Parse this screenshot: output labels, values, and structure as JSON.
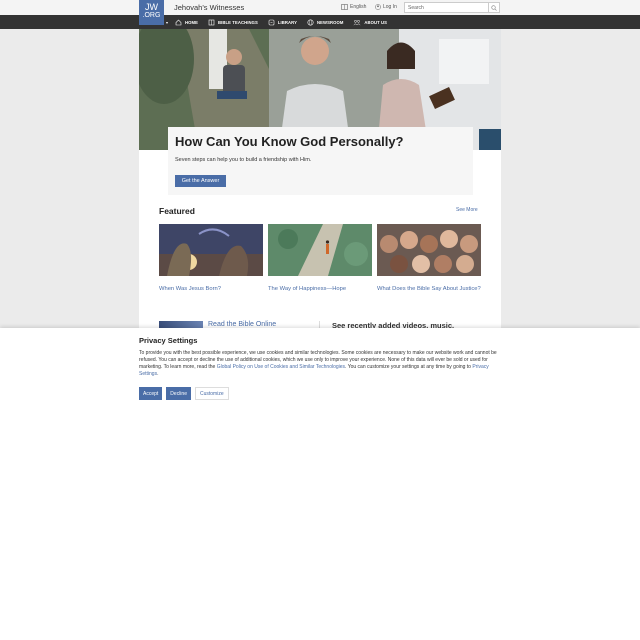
{
  "header": {
    "logo_line1": "JW",
    "logo_line2": ".ORG",
    "site_title": "Jehovah's Witnesses",
    "language_label": "English",
    "login_label": "Log In",
    "search_placeholder": "Search"
  },
  "nav": {
    "items": [
      {
        "label": "HOME"
      },
      {
        "label": "BIBLE TEACHINGS"
      },
      {
        "label": "LIBRARY"
      },
      {
        "label": "NEWSROOM"
      },
      {
        "label": "ABOUT US"
      }
    ]
  },
  "hero": {
    "title": "How Can You Know God Personally?",
    "subtitle": "Seven steps can help you to build a friendship with Him.",
    "button_label": "Get the Answer"
  },
  "featured": {
    "title": "Featured",
    "see_more": "See More",
    "cards": [
      {
        "title": "When Was Jesus Born?"
      },
      {
        "title": "The Way of Happiness—Hope"
      },
      {
        "title": "What Does the Bible Say About Justice?"
      }
    ]
  },
  "lower": {
    "read_bible": "Read the Bible Online",
    "recent_text": "See recently added videos, music,"
  },
  "privacy": {
    "title": "Privacy Settings",
    "text_before_link1": "To provide you with the best possible experience, we use cookies and similar technologies. Some cookies are necessary to make our website work and cannot be refused. You can accept or decline the use of additional cookies, which we use only to improve your experience. None of this data will ever be sold or used for marketing. To learn more, read the ",
    "link1": "Global Policy on Use of Cookies and Similar Technologies",
    "text_between": ". You can customize your settings at any time by going to ",
    "link2": "Privacy Settings",
    "text_end": ".",
    "accept": "Accept",
    "decline": "Decline",
    "customize": "Customize"
  },
  "colors": {
    "brand_blue": "#4a6da7",
    "nav_bg": "#333333",
    "page_bg": "#ebebeb"
  },
  "icons": [
    "language-icon",
    "user-icon",
    "search-icon",
    "home-icon",
    "book-icon",
    "library-icon",
    "globe-icon",
    "people-icon",
    "chevron-down-icon"
  ]
}
